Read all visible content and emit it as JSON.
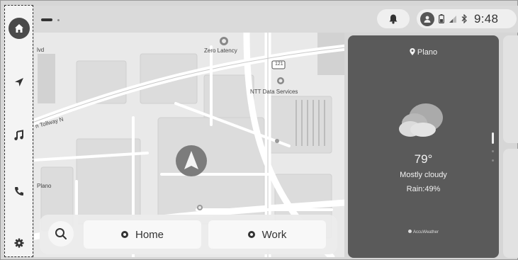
{
  "status_bar": {
    "time": "9:48",
    "icons": [
      "bell-icon",
      "profile-icon",
      "battery-icon",
      "signal-icon",
      "bluetooth-icon"
    ]
  },
  "rail": {
    "items": [
      "home-icon",
      "navigation-icon",
      "music-icon",
      "phone-icon",
      "settings-icon"
    ]
  },
  "map": {
    "labels": {
      "zero_latency": "Zero Latency",
      "road_121": "121",
      "ntt": "NTT Data Services",
      "tollway": "n Tollway N",
      "plano": "Plano",
      "blvd": "lvd"
    }
  },
  "destinations": {
    "home_label": "Home",
    "work_label": "Work"
  },
  "weather": {
    "location": "Plano",
    "temperature": "79°",
    "condition": "Mostly cloudy",
    "rain": "Rain:49%",
    "provider": "AccuWeather"
  },
  "colors": {
    "rail_bg": "#f4f4f4",
    "weather_bg": "#5a5a5a",
    "map_bg": "#e9e9e9"
  }
}
